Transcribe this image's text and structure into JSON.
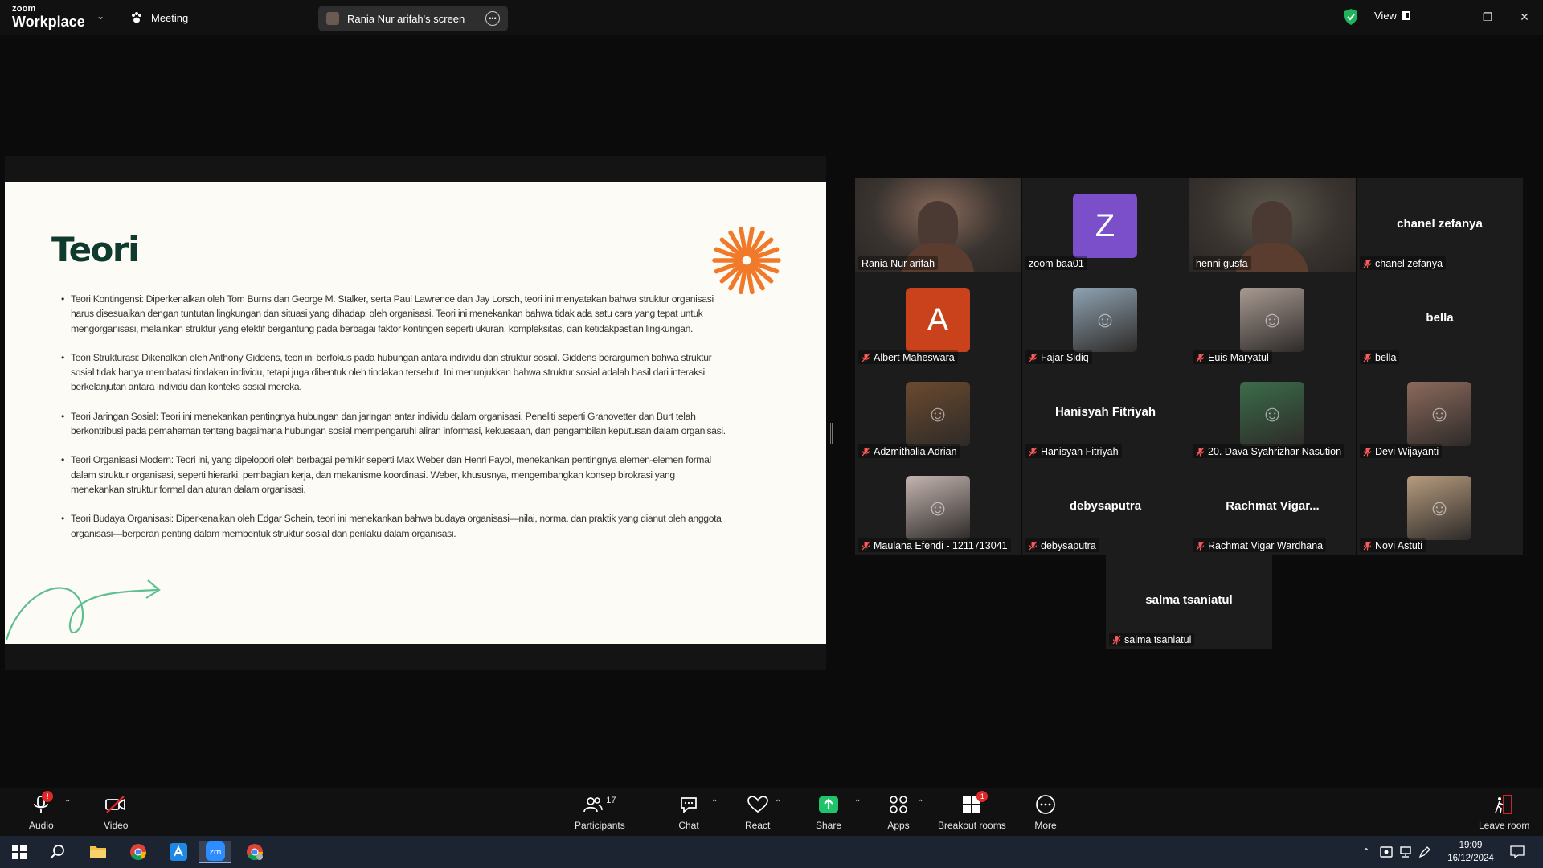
{
  "app": {
    "logo_top": "zoom",
    "logo_bottom": "Workplace",
    "meeting_label": "Meeting",
    "shared_screen_label": "Rania Nur arifah's screen",
    "view_label": "View"
  },
  "slide": {
    "title": "Teori",
    "bullets": [
      "Teori Kontingensi: Diperkenalkan oleh Tom Burns dan George M. Stalker, serta Paul Lawrence dan Jay Lorsch, teori ini menyatakan bahwa struktur organisasi harus disesuaikan dengan tuntutan lingkungan dan situasi yang dihadapi oleh organisasi. Teori ini menekankan bahwa tidak ada satu cara yang tepat untuk mengorganisasi, melainkan struktur yang efektif bergantung pada berbagai faktor kontingen seperti ukuran, kompleksitas, dan ketidakpastian lingkungan.",
      "Teori Strukturasi: Dikenalkan oleh Anthony Giddens, teori ini berfokus pada hubungan antara individu dan struktur sosial. Giddens berargumen bahwa struktur sosial tidak hanya membatasi tindakan individu, tetapi juga dibentuk oleh tindakan tersebut. Ini menunjukkan bahwa struktur sosial adalah hasil dari interaksi berkelanjutan antara individu dan konteks sosial mereka.",
      "Teori Jaringan Sosial: Teori ini menekankan pentingnya hubungan dan jaringan antar individu dalam organisasi. Peneliti seperti Granovetter dan Burt telah berkontribusi pada pemahaman tentang bagaimana hubungan sosial mempengaruhi aliran informasi, kekuasaan, dan pengambilan keputusan dalam organisasi.",
      "Teori Organisasi Modern: Teori ini, yang dipelopori oleh berbagai pemikir seperti Max Weber dan Henri Fayol, menekankan pentingnya elemen-elemen formal dalam struktur organisasi, seperti hierarki, pembagian kerja, dan mekanisme koordinasi. Weber, khususnya, mengembangkan konsep birokrasi yang menekankan struktur formal dan aturan dalam organisasi.",
      "Teori Budaya Organisasi: Diperkenalkan oleh Edgar Schein, teori ini menekankan bahwa budaya organisasi—nilai, norma, dan praktik yang dianut oleh anggota organisasi—berperan penting dalam membentuk struktur sosial dan perilaku dalam organisasi."
    ]
  },
  "participants": [
    {
      "name": "Rania Nur arifah",
      "display": "",
      "kind": "video",
      "muted": false,
      "active": true,
      "avatar_letter": "",
      "color": "#8a6a5a"
    },
    {
      "name": "zoom baa01",
      "display": "",
      "kind": "letter",
      "muted": false,
      "active": false,
      "avatar_letter": "Z",
      "color": "#7b4fc9"
    },
    {
      "name": "henni gusfa",
      "display": "",
      "kind": "video",
      "muted": false,
      "active": false,
      "avatar_letter": "",
      "color": "#5d5a4e"
    },
    {
      "name": "chanel zefanya",
      "display": "chanel zefanya",
      "kind": "text",
      "muted": true,
      "active": false,
      "avatar_letter": "",
      "color": ""
    },
    {
      "name": "Albert Maheswara",
      "display": "",
      "kind": "letter",
      "muted": true,
      "active": false,
      "avatar_letter": "A",
      "color": "#c9421b"
    },
    {
      "name": "Fajar Sidiq",
      "display": "",
      "kind": "photo",
      "muted": true,
      "active": false,
      "avatar_letter": "",
      "color": "#8fa3b2"
    },
    {
      "name": "Euis Maryatul",
      "display": "",
      "kind": "photo",
      "muted": true,
      "active": false,
      "avatar_letter": "",
      "color": "#a89a92"
    },
    {
      "name": "bella",
      "display": "bella",
      "kind": "text",
      "muted": true,
      "active": false,
      "avatar_letter": "",
      "color": ""
    },
    {
      "name": "Adzmithalia Adrian",
      "display": "",
      "kind": "photo",
      "muted": true,
      "active": false,
      "avatar_letter": "",
      "color": "#6b4a2e"
    },
    {
      "name": "Hanisyah Fitriyah",
      "display": "Hanisyah Fitriyah",
      "kind": "text",
      "muted": true,
      "active": false,
      "avatar_letter": "",
      "color": ""
    },
    {
      "name": "20. Dava Syahrizhar Nasution",
      "display": "",
      "kind": "photo",
      "muted": true,
      "active": false,
      "avatar_letter": "",
      "color": "#3b6d4a"
    },
    {
      "name": "Devi Wijayanti",
      "display": "",
      "kind": "photo",
      "muted": true,
      "active": false,
      "avatar_letter": "",
      "color": "#8c6a5c"
    },
    {
      "name": "Maulana Efendi - 1211713041",
      "display": "",
      "kind": "photo",
      "muted": true,
      "active": false,
      "avatar_letter": "",
      "color": "#c4b5b0"
    },
    {
      "name": "debysaputra",
      "display": "debysaputra",
      "kind": "text",
      "muted": true,
      "active": false,
      "avatar_letter": "",
      "color": ""
    },
    {
      "name": "Rachmat Vigar Wardhana",
      "display": "Rachmat  Vigar...",
      "kind": "text",
      "muted": true,
      "active": false,
      "avatar_letter": "",
      "color": ""
    },
    {
      "name": "Novi Astuti",
      "display": "",
      "kind": "photo",
      "muted": true,
      "active": false,
      "avatar_letter": "",
      "color": "#b79c7f"
    },
    {
      "name": "salma tsaniatul",
      "display": "salma tsaniatul",
      "kind": "text",
      "muted": true,
      "active": false,
      "avatar_letter": "",
      "color": ""
    }
  ],
  "toolbar": {
    "audio": "Audio",
    "video": "Video",
    "participants": "Participants",
    "participants_count": "17",
    "chat": "Chat",
    "react": "React",
    "share": "Share",
    "apps": "Apps",
    "breakout": "Breakout rooms",
    "breakout_badge": "1",
    "more": "More",
    "leave": "Leave room"
  },
  "taskbar": {
    "time": "19:09",
    "date": "16/12/2024"
  },
  "colors": {
    "active_border": "#1dc36b",
    "share_green": "#1fc46a",
    "slide_title": "#0f3b2e",
    "sunburst": "#f07a2a",
    "swirl": "#5fbf90"
  }
}
